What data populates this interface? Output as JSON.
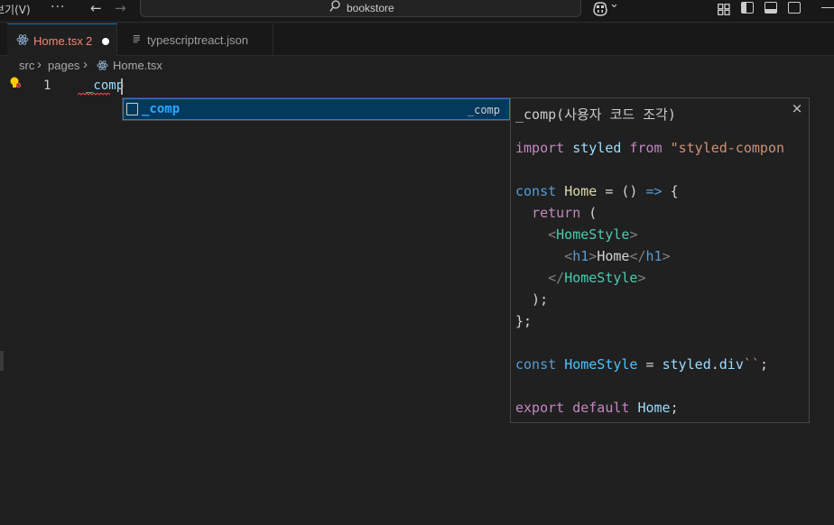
{
  "titlebar": {
    "menu_view": "보기(V)",
    "more": "···",
    "nav_back": "←",
    "nav_forward": "→",
    "search_text": "bookstore",
    "copilot_chevron": "⌄"
  },
  "tabs": [
    {
      "label": "Home.tsx",
      "badge": "2",
      "state": "active-modified",
      "icon": "react-icon"
    },
    {
      "label": "typescriptreact.json",
      "state": "inactive",
      "icon": "json-lines-icon"
    }
  ],
  "breadcrumb": {
    "items": [
      "src",
      "pages",
      "Home.tsx"
    ],
    "separator": "›"
  },
  "editor": {
    "line_number": "1",
    "line_text": "_comp",
    "squiggle_color": "#f14c4c"
  },
  "suggest": {
    "label": "_comp",
    "detail": "_comp",
    "icon": "snippet-icon"
  },
  "detail_panel": {
    "title": "_comp(사용자 코드 조각)",
    "close": "×",
    "code": [
      [
        {
          "t": "import",
          "c": "t-kw"
        },
        {
          "t": " ",
          "c": "t-txt"
        },
        {
          "t": "styled",
          "c": "t-var"
        },
        {
          "t": " ",
          "c": "t-txt"
        },
        {
          "t": "from",
          "c": "t-kw"
        },
        {
          "t": " ",
          "c": "t-txt"
        },
        {
          "t": "\"styled-compon",
          "c": "t-str"
        }
      ],
      [],
      [
        {
          "t": "const",
          "c": "t-decl"
        },
        {
          "t": " ",
          "c": "t-txt"
        },
        {
          "t": "Home",
          "c": "t-fn"
        },
        {
          "t": " = ",
          "c": "t-op"
        },
        {
          "t": "()",
          "c": "t-punc"
        },
        {
          "t": " ",
          "c": "t-txt"
        },
        {
          "t": "=>",
          "c": "t-decl"
        },
        {
          "t": " {",
          "c": "t-punc"
        }
      ],
      [
        {
          "t": "  ",
          "c": "t-txt"
        },
        {
          "t": "return",
          "c": "t-kw"
        },
        {
          "t": " (",
          "c": "t-punc"
        }
      ],
      [
        {
          "t": "    ",
          "c": "t-txt"
        },
        {
          "t": "<",
          "c": "t-br"
        },
        {
          "t": "HomeStyle",
          "c": "t-tag"
        },
        {
          "t": ">",
          "c": "t-br"
        }
      ],
      [
        {
          "t": "      ",
          "c": "t-txt"
        },
        {
          "t": "<",
          "c": "t-br"
        },
        {
          "t": "h1",
          "c": "t-decl"
        },
        {
          "t": ">",
          "c": "t-br"
        },
        {
          "t": "Home",
          "c": "t-txt"
        },
        {
          "t": "</",
          "c": "t-br"
        },
        {
          "t": "h1",
          "c": "t-decl"
        },
        {
          "t": ">",
          "c": "t-br"
        }
      ],
      [
        {
          "t": "    ",
          "c": "t-txt"
        },
        {
          "t": "</",
          "c": "t-br"
        },
        {
          "t": "HomeStyle",
          "c": "t-tag"
        },
        {
          "t": ">",
          "c": "t-br"
        }
      ],
      [
        {
          "t": "  );",
          "c": "t-punc"
        }
      ],
      [
        {
          "t": "};",
          "c": "t-punc"
        }
      ],
      [],
      [
        {
          "t": "const",
          "c": "t-decl"
        },
        {
          "t": " ",
          "c": "t-txt"
        },
        {
          "t": "HomeStyle",
          "c": "t-cyan"
        },
        {
          "t": " = ",
          "c": "t-op"
        },
        {
          "t": "styled",
          "c": "t-var"
        },
        {
          "t": ".",
          "c": "t-punc"
        },
        {
          "t": "div",
          "c": "t-var"
        },
        {
          "t": "``",
          "c": "t-str"
        },
        {
          "t": ";",
          "c": "t-punc"
        }
      ],
      [],
      [
        {
          "t": "export",
          "c": "t-kw"
        },
        {
          "t": " ",
          "c": "t-txt"
        },
        {
          "t": "default",
          "c": "t-kw"
        },
        {
          "t": " ",
          "c": "t-txt"
        },
        {
          "t": "Home",
          "c": "t-var"
        },
        {
          "t": ";",
          "c": "t-punc"
        }
      ]
    ]
  },
  "colors": {
    "accent": "#0078d4",
    "modified_tab": "#f48771",
    "suggest_highlight": "#2aaaff"
  }
}
